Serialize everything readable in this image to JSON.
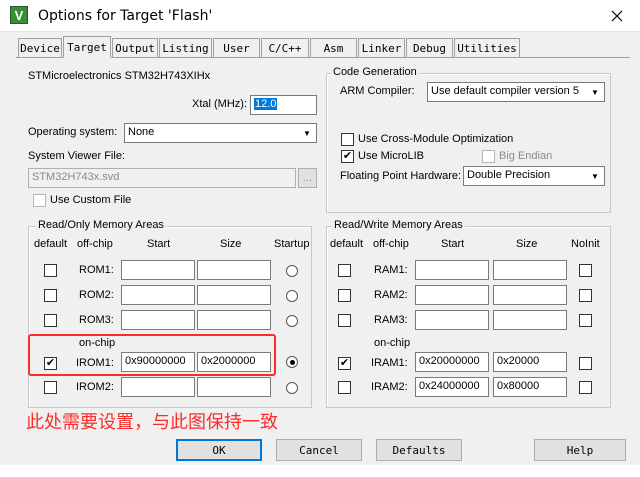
{
  "window": {
    "icon_glyph": "V",
    "title": "Options for Target 'Flash'",
    "close_glyph": "✕"
  },
  "tabs": [
    "Device",
    "Target",
    "Output",
    "Listing",
    "User",
    "C/C++",
    "Asm",
    "Linker",
    "Debug",
    "Utilities"
  ],
  "active_tab": "Target",
  "device": {
    "name": "STMicroelectronics STM32H743XIHx",
    "xtal_label": "Xtal (MHz):",
    "xtal_value": "12.0",
    "os_label": "Operating system:",
    "os_value": "None",
    "svd_label": "System Viewer File:",
    "svd_value": "STM32H743x.svd",
    "browse_label": "...",
    "custom_file_label": "Use Custom File"
  },
  "codegen": {
    "title": "Code Generation",
    "compiler_label": "ARM Compiler:",
    "compiler_value": "Use default compiler version 5",
    "cross_module_label": "Use Cross-Module Optimization",
    "microlib_label": "Use MicroLIB",
    "big_endian_label": "Big Endian",
    "fpu_label": "Floating Point Hardware:",
    "fpu_value": "Double Precision"
  },
  "rom": {
    "title": "Read/Only Memory Areas",
    "headers": {
      "default": "default",
      "offchip": "off-chip",
      "start": "Start",
      "size": "Size",
      "startup": "Startup"
    },
    "onchip_label": "on-chip",
    "rows": [
      {
        "label": "ROM1:",
        "start": "",
        "size": "",
        "default": false,
        "startup": false
      },
      {
        "label": "ROM2:",
        "start": "",
        "size": "",
        "default": false,
        "startup": false
      },
      {
        "label": "ROM3:",
        "start": "",
        "size": "",
        "default": false,
        "startup": false
      },
      {
        "label": "IROM1:",
        "start": "0x90000000",
        "size": "0x2000000",
        "default": true,
        "startup": true
      },
      {
        "label": "IROM2:",
        "start": "",
        "size": "",
        "default": false,
        "startup": false
      }
    ]
  },
  "ram": {
    "title": "Read/Write Memory Areas",
    "headers": {
      "default": "default",
      "offchip": "off-chip",
      "start": "Start",
      "size": "Size",
      "noinit": "NoInit"
    },
    "onchip_label": "on-chip",
    "rows": [
      {
        "label": "RAM1:",
        "start": "",
        "size": "",
        "default": false
      },
      {
        "label": "RAM2:",
        "start": "",
        "size": "",
        "default": false
      },
      {
        "label": "RAM3:",
        "start": "",
        "size": "",
        "default": false
      },
      {
        "label": "IRAM1:",
        "start": "0x20000000",
        "size": "0x20000",
        "default": true
      },
      {
        "label": "IRAM2:",
        "start": "0x24000000",
        "size": "0x80000",
        "default": false
      }
    ]
  },
  "annotation": "此处需要设置，与此图保持一致",
  "buttons": {
    "ok": "OK",
    "cancel": "Cancel",
    "defaults": "Defaults",
    "help": "Help"
  },
  "colors": {
    "accent": "#0078d7",
    "annotation_red": "#ff2a2a"
  }
}
